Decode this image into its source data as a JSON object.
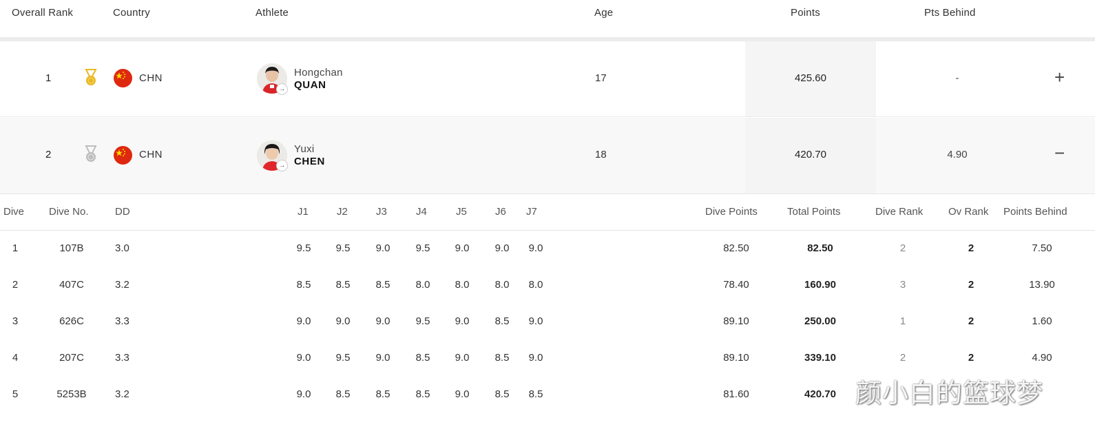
{
  "header": {
    "overall_rank": "Overall Rank",
    "country": "Country",
    "athlete": "Athlete",
    "age": "Age",
    "points": "Points",
    "pts_behind": "Pts Behind"
  },
  "athletes": [
    {
      "rank": "1",
      "medal": "gold-medal-icon",
      "country_code": "CHN",
      "first_name": "Hongchan",
      "last_name": "QUAN",
      "age": "17",
      "points": "425.60",
      "pts_behind": "-",
      "toggle": "+"
    },
    {
      "rank": "2",
      "medal": "silver-medal-icon",
      "country_code": "CHN",
      "first_name": "Yuxi",
      "last_name": "CHEN",
      "age": "18",
      "points": "420.70",
      "pts_behind": "4.90",
      "toggle": "−"
    }
  ],
  "dive_table": {
    "headers": {
      "dive": "Dive",
      "dive_no": "Dive No.",
      "dd": "DD",
      "j1": "J1",
      "j2": "J2",
      "j3": "J3",
      "j4": "J4",
      "j5": "J5",
      "j6": "J6",
      "j7": "J7",
      "dive_points": "Dive Points",
      "total_points": "Total Points",
      "dive_rank": "Dive Rank",
      "ov_rank": "Ov Rank",
      "points_behind": "Points Behind"
    },
    "rows": [
      {
        "dive": "1",
        "dive_no": "107B",
        "dd": "3.0",
        "judges": [
          "9.5",
          "9.5",
          "9.0",
          "9.5",
          "9.0",
          "9.0",
          "9.0"
        ],
        "dive_points": "82.50",
        "total_points": "82.50",
        "dive_rank": "2",
        "ov_rank": "2",
        "points_behind": "7.50"
      },
      {
        "dive": "2",
        "dive_no": "407C",
        "dd": "3.2",
        "judges": [
          "8.5",
          "8.5",
          "8.5",
          "8.0",
          "8.0",
          "8.0",
          "8.0"
        ],
        "dive_points": "78.40",
        "total_points": "160.90",
        "dive_rank": "3",
        "ov_rank": "2",
        "points_behind": "13.90"
      },
      {
        "dive": "3",
        "dive_no": "626C",
        "dd": "3.3",
        "judges": [
          "9.0",
          "9.0",
          "9.0",
          "9.5",
          "9.0",
          "8.5",
          "9.0"
        ],
        "dive_points": "89.10",
        "total_points": "250.00",
        "dive_rank": "1",
        "ov_rank": "2",
        "points_behind": "1.60"
      },
      {
        "dive": "4",
        "dive_no": "207C",
        "dd": "3.3",
        "judges": [
          "9.0",
          "9.5",
          "9.0",
          "8.5",
          "9.0",
          "8.5",
          "9.0"
        ],
        "dive_points": "89.10",
        "total_points": "339.10",
        "dive_rank": "2",
        "ov_rank": "2",
        "points_behind": "4.90"
      },
      {
        "dive": "5",
        "dive_no": "5253B",
        "dd": "3.2",
        "judges": [
          "9.0",
          "8.5",
          "8.5",
          "8.5",
          "9.0",
          "8.5",
          "8.5"
        ],
        "dive_points": "81.60",
        "total_points": "420.70",
        "dive_rank": "",
        "ov_rank": "",
        "points_behind": ""
      }
    ]
  },
  "watermark": "颜小白的篮球梦",
  "colors": {
    "gold": "#e8b923",
    "silver": "#bdbdbd",
    "flag_red": "#de2910",
    "flag_star": "#ffde00",
    "header_divider": "#ececec"
  }
}
